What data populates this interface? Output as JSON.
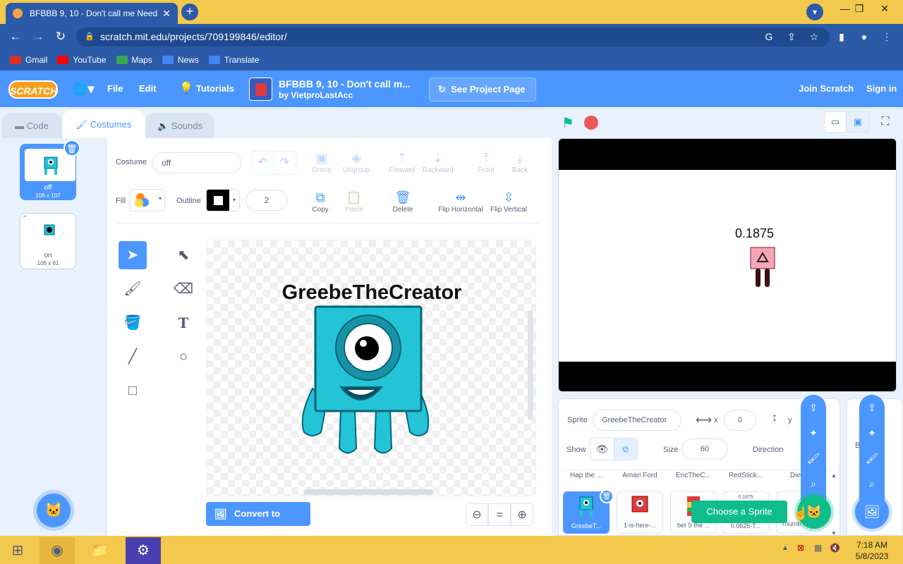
{
  "browser": {
    "tab_title": "BFBBB 9, 10 - Don't call me Need",
    "url": "scratch.mit.edu/projects/709199846/editor/",
    "bookmarks": [
      {
        "label": "Gmail",
        "icon": "gmail-icon",
        "color": "#d93025"
      },
      {
        "label": "YouTube",
        "icon": "youtube-icon",
        "color": "#ff0000"
      },
      {
        "label": "Maps",
        "icon": "maps-icon",
        "color": "#34a853"
      },
      {
        "label": "News",
        "icon": "news-icon",
        "color": "#4285f4"
      },
      {
        "label": "Translate",
        "icon": "translate-icon",
        "color": "#4285f4"
      }
    ]
  },
  "menu": {
    "logo": "SCRATCH",
    "file": "File",
    "edit": "Edit",
    "tutorials": "Tutorials",
    "project_title": "BFBBB 9, 10 - Don't call m...",
    "project_by": "by VietproLastAcc",
    "see_project": "See Project Page",
    "join": "Join Scratch",
    "signin": "Sign in"
  },
  "tabs": {
    "code": "Code",
    "costumes": "Costumes",
    "sounds": "Sounds"
  },
  "costumes": [
    {
      "num": "1",
      "name": "off",
      "size": "106 x 107"
    },
    {
      "num": "2",
      "name": "on",
      "size": "106 x 81"
    }
  ],
  "paint": {
    "costume_label": "Costume",
    "costume_name": "off",
    "fill_label": "Fill",
    "outline_label": "Outline",
    "outline_width": "2",
    "group": "Group",
    "ungroup": "Ungroup",
    "forward": "Forward",
    "backward": "Backward",
    "front": "Front",
    "back": "Back",
    "copy": "Copy",
    "paste": "Paste",
    "delete": "Delete",
    "flip_h": "Flip Horizontal",
    "flip_v": "Flip Vertical",
    "canvas_text": "GreebeTheCreator",
    "convert": "Convert to Bitmap",
    "zoom_eq": "="
  },
  "stage": {
    "value_text": "0.1875"
  },
  "sprite_info": {
    "sprite_label": "Sprite",
    "sprite_name": "GreebeTheCreator",
    "x_label": "x",
    "x_value": "0",
    "y_label": "y",
    "show_label": "Show",
    "size_label": "Size",
    "size_value": "60",
    "direction_label": "Direction"
  },
  "sprite_names_top": [
    "Hap the ...",
    "Amari Ford",
    "EricTheC...",
    "RedStick...",
    "Diego"
  ],
  "sprite_tiles": [
    {
      "name": "GreebeT...",
      "top": ""
    },
    {
      "name": "1-is-here-...",
      "top": ""
    },
    {
      "name": "bet S the ...",
      "top": ""
    },
    {
      "name": "0.0625-T...",
      "top": "0.1875"
    },
    {
      "name": "Thumb...",
      "top": ""
    }
  ],
  "choose_sprite": "Choose a Sprite",
  "stage_panel_label": "B",
  "taskbar": {
    "time": "7:18 AM",
    "date": "5/8/2023"
  }
}
